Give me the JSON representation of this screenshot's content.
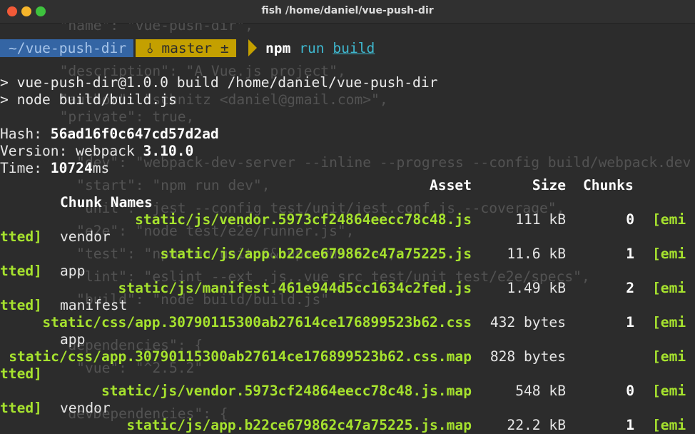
{
  "window": {
    "title": "fish  /home/daniel/vue-push-dir"
  },
  "background_code": [
    "  \"name\": \"vue-push-dir\",",
    "  \"description\": \"A Vue.js project\",",
    "  \"author\": \"schnitz <daniel@gmail.com>\",",
    "  \"private\": true,",
    "    \"dev\": \"webpack-dev-server --inline --progress --config build/webpack.dev",
    "    \"start\": \"npm run dev\",",
    "    \"unit\": \"jest --config test/unit/jest.conf.js --coverage\",",
    "    \"e2e\": \"node test/e2e/runner.js\",",
    "    \"test\": \"npm run unit && npm run e2e\",",
    "    \"lint\": \"eslint --ext .js,.vue src test/unit test/e2e/specs\",",
    "    \"build\": \"node build/build.js\"",
    "  \"dependencies\": {",
    "    \"vue\": \"^2.5.2\"",
    "  \"devDependencies\": {"
  ],
  "prompt": {
    "directory": "~/vue-push-dir",
    "branch_icon": "branch-icon",
    "branch": "master ±",
    "command": "npm",
    "subcommand": "run",
    "argument": "build"
  },
  "npm_output": {
    "line1": "> vue-push-dir@1.0.0 build /home/daniel/vue-push-dir",
    "line2": "> node build/build.js"
  },
  "stats": {
    "hash_label": "Hash: ",
    "hash": "56ad16f0c647cd57d2ad",
    "version_label": "Version: webpack ",
    "version": "3.10.0",
    "time_label": "Time: ",
    "time": "10724",
    "time_unit": "ms"
  },
  "table": {
    "headers": {
      "asset": "Asset",
      "size": "Size",
      "chunks": "Chunks",
      "chunk_names": "Chunk Names"
    },
    "emitted_start": "[emi",
    "emitted_end": "tted]",
    "rows": [
      {
        "asset": "static/js/vendor.5973cf24864eecc78c48.js",
        "size": "111 kB",
        "chunk": "0",
        "name": "vendor"
      },
      {
        "asset": "static/js/app.b22ce679862c47a75225.js",
        "size": "11.6 kB",
        "chunk": "1",
        "name": "app"
      },
      {
        "asset": "static/js/manifest.461e944d5cc1634c2fed.js",
        "size": "1.49 kB",
        "chunk": "2",
        "name": "manifest"
      },
      {
        "asset": "static/css/app.30790115300ab27614ce176899523b62.css",
        "size": "432 bytes",
        "chunk": "1",
        "name": "app"
      },
      {
        "asset": "static/css/app.30790115300ab27614ce176899523b62.css.map",
        "size": "828 bytes",
        "chunk": "",
        "name": ""
      },
      {
        "asset": "static/js/vendor.5973cf24864eecc78c48.js.map",
        "size": "548 kB",
        "chunk": "0",
        "name": "vendor"
      },
      {
        "asset": "static/js/app.b22ce679862c47a75225.js.map",
        "size": "22.2 kB",
        "chunk": "1",
        "name": ""
      }
    ]
  },
  "colors": {
    "background": "#2c2c2c",
    "prompt_dir_bg": "#3465a4",
    "prompt_git_bg": "#c4a000",
    "asset_green": "#a6e22e",
    "command_cyan": "#3fb8cf"
  }
}
